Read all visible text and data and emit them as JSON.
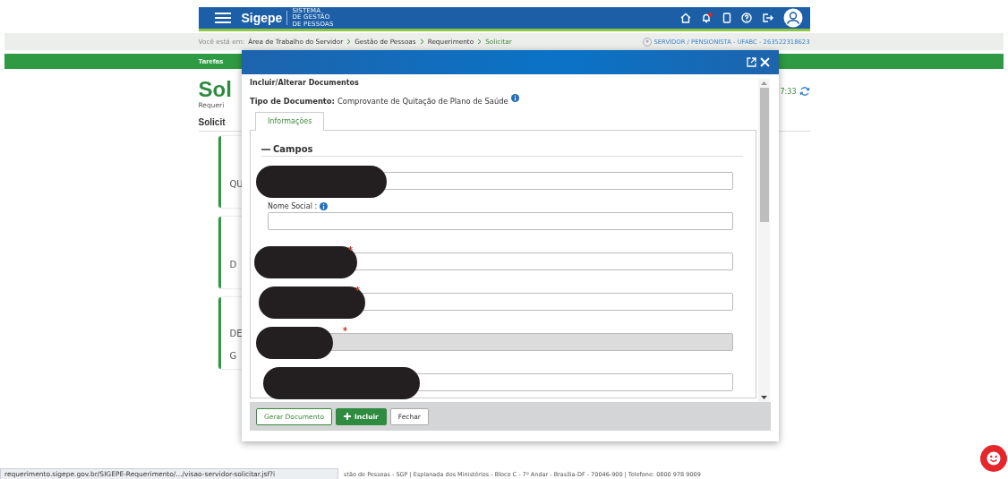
{
  "header": {
    "logo": "Sigepe",
    "logo_subtitle": [
      "SISTEMA",
      "DE GESTÃO",
      "DE PESSOAS"
    ],
    "notification": true
  },
  "breadcrumb": {
    "prefix": "Você está em:",
    "items": [
      {
        "label": "Área de Trabalho do Servidor",
        "selected": false
      },
      {
        "label": "Gestão de Pessoas",
        "selected": false
      },
      {
        "label": "Requerimento",
        "selected": false
      },
      {
        "label": "Solicitar",
        "selected": true
      }
    ],
    "profile": "SERVIDOR / PENSIONISTA - UFABC - 263522318623"
  },
  "task_bar": {
    "label": "Tarefas"
  },
  "page": {
    "title": "Sol",
    "subtitle": "Requeri",
    "section": "Solicit",
    "time": "7:33",
    "cards": [
      {
        "lines": [
          "QU"
        ]
      },
      {
        "lines": [
          "D"
        ]
      },
      {
        "lines": [
          "DE",
          "G"
        ]
      }
    ]
  },
  "modal": {
    "heading": "Incluir/Alterar Documentos",
    "doc_type_label": "Tipo de Documento:",
    "doc_type": "Comprovante de Quitação de Plano de Saúde",
    "tabs": [
      {
        "label": "Informações",
        "selected": true
      }
    ],
    "section": "Campos",
    "expanded": true,
    "fields": [
      {
        "redacted": true,
        "required": false,
        "info": false,
        "disabled": false
      },
      {
        "label": "Nome Social :",
        "redacted": false,
        "required": false,
        "info": true,
        "disabled": false
      },
      {
        "redacted": true,
        "required": true,
        "info": false,
        "disabled": false
      },
      {
        "redacted": true,
        "required": true,
        "info": false,
        "disabled": false
      },
      {
        "redacted": true,
        "required": true,
        "info": false,
        "disabled": true
      },
      {
        "redacted": true,
        "required": false,
        "info": false,
        "disabled": false
      }
    ],
    "buttons": [
      {
        "label": "Gerar Documento",
        "kind": "outline"
      },
      {
        "label": "Incluir",
        "kind": "primary"
      },
      {
        "label": "Fechar",
        "kind": "plain"
      }
    ]
  },
  "footer": {
    "status_url": "requerimento.sigepe.gov.br/SIGEPE-Requerimento/.../visao-servidor-solicitar.jsf?i",
    "text": "stão de Pessoas - SGP | Esplanada dos Ministérios - Bloco C - 7º Andar - Brasília-DF - 70046-900 | Telefone: 0800 978 9009"
  }
}
